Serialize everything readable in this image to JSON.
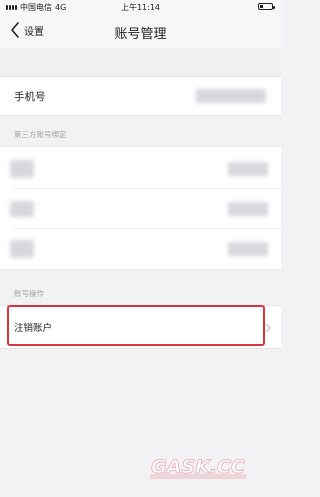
{
  "status_bar": {
    "carrier": "中国电信",
    "network": "4G",
    "time": "上午11:14",
    "battery_level": 0.25
  },
  "nav": {
    "back_label": "设置",
    "title": "账号管理"
  },
  "phone": {
    "label": "手机号"
  },
  "third_party": {
    "header": "第三方账号绑定",
    "rows": [
      {
        "name": ""
      },
      {
        "name": ""
      },
      {
        "name": ""
      }
    ]
  },
  "account_ops": {
    "header": "账号操作",
    "cancel_label": "注销账户"
  },
  "watermark": {
    "text": "GASK.CC"
  },
  "colors": {
    "accent_red": "#d9343a",
    "background": "#f2f2f4",
    "header_text": "#a0a0a6"
  }
}
